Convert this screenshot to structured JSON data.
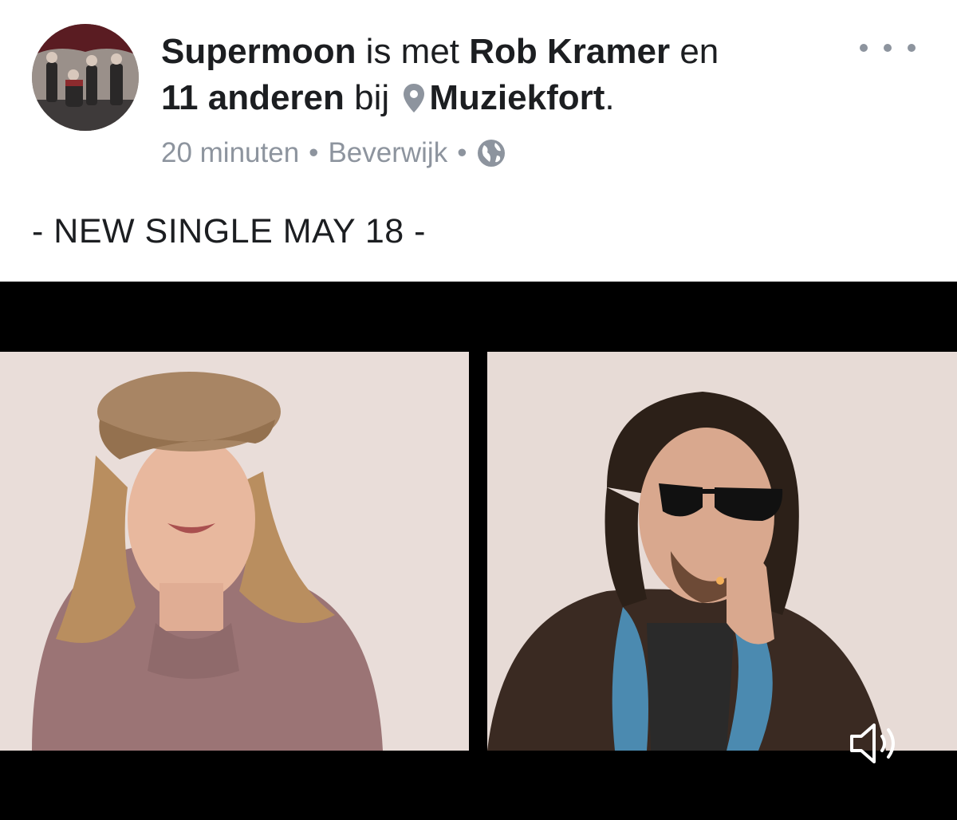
{
  "post": {
    "author": "Supermoon",
    "with_text": " is met ",
    "tagged_person": "Rob Kramer",
    "and_text": " en ",
    "others": "11 anderen",
    "at_text": " bij ",
    "place": "Muziekfort",
    "period": ".",
    "time": "20 minuten",
    "separator": "•",
    "location": "Beverwijk",
    "body_text": "- NEW SINGLE MAY 18 -"
  },
  "icons": {
    "more": "more-horizontal-icon",
    "pin": "location-pin-icon",
    "globe": "globe-icon",
    "sound": "speaker-icon"
  },
  "colors": {
    "text": "#1c1e21",
    "meta": "#8d949e",
    "video_bg": "#000000"
  }
}
